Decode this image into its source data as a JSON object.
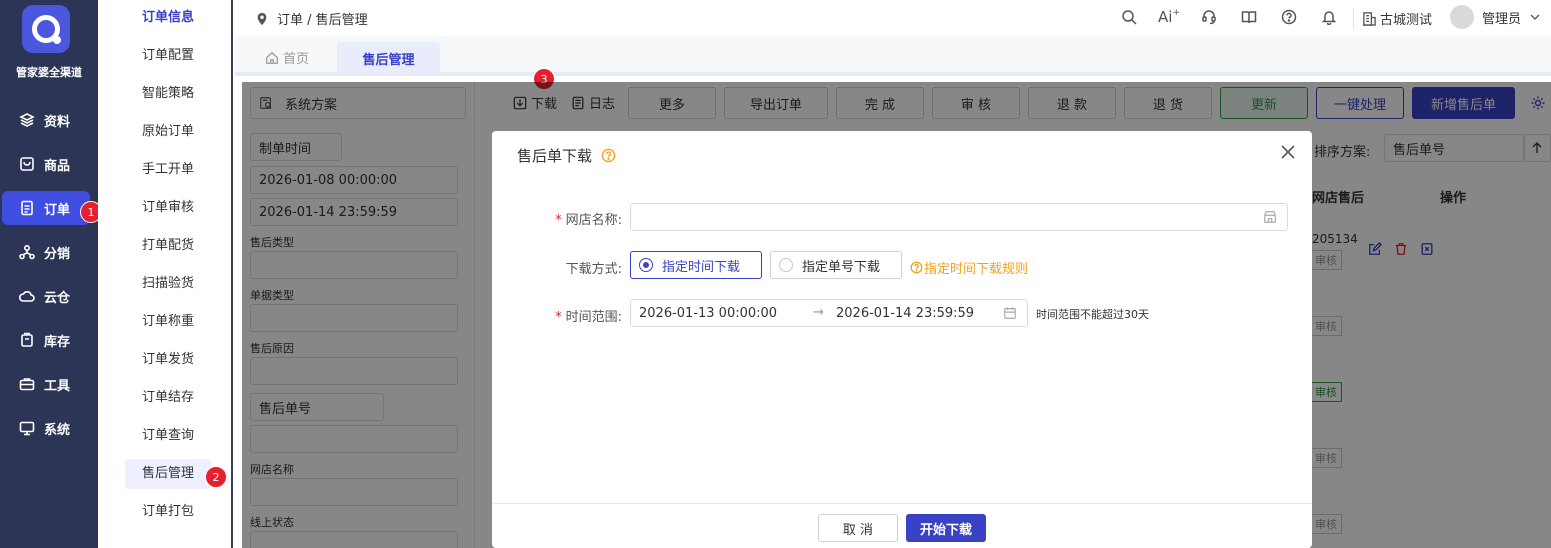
{
  "brand": {
    "name": "管家婆全渠道"
  },
  "nav": {
    "items": [
      {
        "label": "资料",
        "icon": "layers-icon"
      },
      {
        "label": "商品",
        "icon": "bag-icon"
      },
      {
        "label": "订单",
        "icon": "document-icon"
      },
      {
        "label": "分销",
        "icon": "network-icon"
      },
      {
        "label": "云仓",
        "icon": "cloud-icon"
      },
      {
        "label": "库存",
        "icon": "inventory-icon"
      },
      {
        "label": "工具",
        "icon": "toolbox-icon"
      },
      {
        "label": "系统",
        "icon": "monitor-icon"
      }
    ],
    "active_index": 2
  },
  "submenu": {
    "items": [
      "订单信息",
      "订单配置",
      "智能策略",
      "原始订单",
      "手工开单",
      "订单审核",
      "打单配货",
      "扫描验货",
      "订单称重",
      "订单发货",
      "订单结存",
      "订单查询",
      "售后管理",
      "订单打包"
    ],
    "active": "售后管理"
  },
  "badges": {
    "b1": "1",
    "b2": "2",
    "b3": "3"
  },
  "header": {
    "breadcrumb": "订单 / 售后管理",
    "ai_label": "Ai",
    "tenant": "古城测试",
    "user": "管理员"
  },
  "tabs": [
    {
      "label": "首页"
    },
    {
      "label": "售后管理"
    }
  ],
  "filter": {
    "scheme": "系统方案",
    "date_type": "制单时间",
    "start": "2026-01-08 00:00:00",
    "end": "2026-01-14 23:59:59",
    "labels": {
      "after_type": "售后类型",
      "doc_type": "单据类型",
      "reason": "售后原因",
      "shop": "网店名称",
      "online_status": "线上状态"
    },
    "number_type": "售后单号"
  },
  "toolbar": {
    "download": "下载",
    "log": "日志",
    "more": "更多",
    "export": "导出订单",
    "complete": "完 成",
    "audit": "审 核",
    "refund": "退 款",
    "return": "退 货",
    "update": "更新",
    "one_click": "一键处理",
    "new_after": "新增售后单"
  },
  "table": {
    "sort_label": "排序方案:",
    "sort_value": "售后单号",
    "col_shop": "网店售后",
    "col_ops": "操作",
    "cell_number": "205134",
    "status_label": "审核"
  },
  "colors": {
    "primary": "#3941c4",
    "nav_bg": "#2c3556",
    "nav_active": "#3f4de0",
    "badge": "#e5202e",
    "hint": "#f3a21b",
    "update_green": "#2e9e49"
  },
  "modal": {
    "title": "售后单下载",
    "shop_label": "网店名称:",
    "shop_value": "",
    "mode_label": "下载方式:",
    "mode_options": [
      "指定时间下载",
      "指定单号下载"
    ],
    "mode_selected": "指定时间下载",
    "rule_link": "指定时间下载规则",
    "range_label": "时间范围:",
    "range_start": "2026-01-13 00:00:00",
    "range_end": "2026-01-14 23:59:59",
    "range_hint": "时间范围不能超过30天",
    "cancel": "取 消",
    "start": "开始下载"
  }
}
